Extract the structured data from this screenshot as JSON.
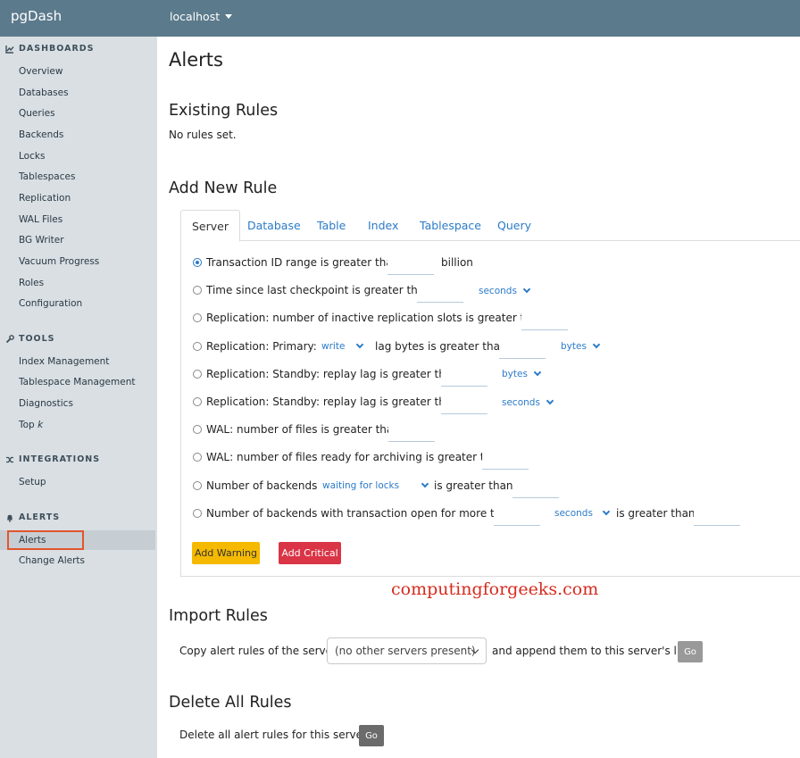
{
  "topbar": {
    "brand": "pgDash",
    "host": "localhost"
  },
  "sidebar": {
    "dashboards_heading": "DASHBOARDS",
    "dashboards": [
      "Overview",
      "Databases",
      "Queries",
      "Backends",
      "Locks",
      "Tablespaces",
      "Replication",
      "WAL Files",
      "BG Writer",
      "Vacuum Progress",
      "Roles",
      "Configuration"
    ],
    "tools_heading": "TOOLS",
    "tools": [
      "Index Management",
      "Tablespace Management",
      "Diagnostics"
    ],
    "top_k_prefix": "Top ",
    "top_k_var": "k",
    "integrations_heading": "INTEGRATIONS",
    "integrations": [
      "Setup"
    ],
    "alerts_heading": "ALERTS",
    "alerts": [
      "Alerts",
      "Change Alerts"
    ]
  },
  "main": {
    "title": "Alerts",
    "existing_heading": "Existing Rules",
    "no_rules": "No rules set.",
    "add_heading": "Add New Rule",
    "tabs": [
      "Server",
      "Database",
      "Table",
      "Index",
      "Tablespace",
      "Query"
    ],
    "rules": {
      "r1": {
        "label": "Transaction ID range is greater than",
        "suffix": "billion"
      },
      "r2": {
        "label": "Time since last checkpoint is greater than",
        "unit": "seconds"
      },
      "r3": {
        "label": "Replication: number of inactive replication slots is greater than"
      },
      "r4": {
        "label": "Replication: Primary:",
        "mode": "write",
        "mid": "lag bytes is greater than",
        "unit": "bytes"
      },
      "r5": {
        "label": "Replication: Standby: replay lag is greater than",
        "unit": "bytes"
      },
      "r6": {
        "label": "Replication: Standby: replay lag is greater than",
        "unit": "seconds"
      },
      "r7": {
        "label": "WAL: number of files is greater than"
      },
      "r8": {
        "label": "WAL: number of files ready for archiving is greater than"
      },
      "r9": {
        "label": "Number of backends",
        "filter": "waiting for locks",
        "mid": "is greater than"
      },
      "r10": {
        "label": "Number of backends with transaction open for more than",
        "unit": "seconds",
        "mid": "is greater than"
      }
    },
    "add_warning": "Add Warning",
    "add_critical": "Add Critical",
    "watermark": "computingforgeeks.com",
    "import_heading": "Import Rules",
    "import_prefix": "Copy alert rules of the server",
    "import_select": "(no other servers present)",
    "import_suffix": "and append them to this server's list",
    "go": "Go",
    "delete_heading": "Delete All Rules",
    "delete_text": "Delete all alert rules for this server"
  },
  "colors": {
    "topbar": "#5b7a8c",
    "sidebar": "#d9dfe3",
    "link": "#2b7bc9",
    "warning": "#f5b900",
    "critical": "#d93546",
    "highlight": "#e0552d"
  }
}
